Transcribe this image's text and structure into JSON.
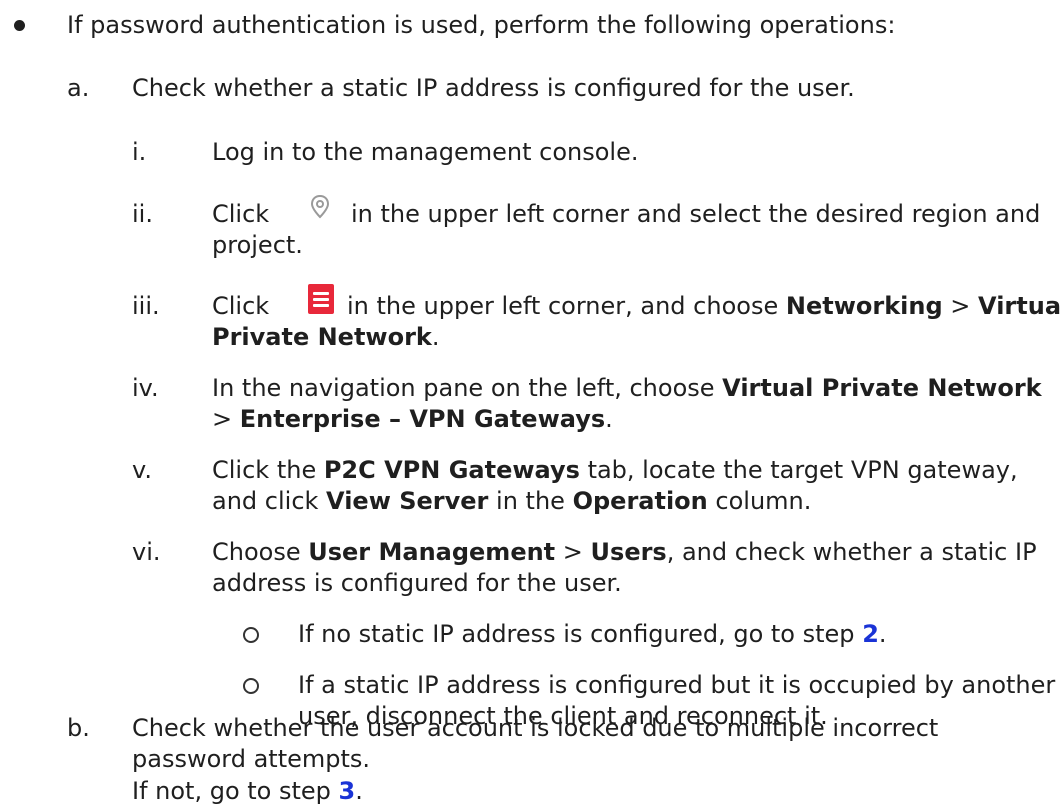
{
  "bullet_intro": "If password authentication is used, perform the following operations:",
  "step_a": {
    "marker": "a.",
    "text": "Check whether a static IP address is configured for the user.",
    "substeps": {
      "i": {
        "marker": "i.",
        "text": "Log in to the management console."
      },
      "ii": {
        "marker": "ii.",
        "text1_pre": "Click",
        "text1_post": "in the upper left corner and select the desired region and",
        "text2": "project.",
        "icon": "location-pin-icon"
      },
      "iii": {
        "marker": "iii.",
        "text1_pre": "Click",
        "text1_mid": "in the upper left corner, and choose",
        "bold1": "Networking",
        "sep": ">",
        "bold2": "Virtual",
        "bold3": "Private Network",
        "end": ".",
        "icon": "hamburger-menu-icon"
      },
      "iv": {
        "marker": "iv.",
        "text1": "In the navigation pane on the left, choose",
        "bold1": "Virtual Private Network",
        "sep": ">",
        "bold2": "Enterprise – VPN Gateways",
        "end": "."
      },
      "v": {
        "marker": "v.",
        "pre": "Click the",
        "bold1": "P2C VPN Gateways",
        "mid": "tab, locate the target VPN gateway,",
        "line2_pre": "and click",
        "bold2": "View Server",
        "line2_mid": "in the",
        "bold3": "Operation",
        "line2_end": "column."
      },
      "vi": {
        "marker": "vi.",
        "pre": "Choose",
        "bold1": "User Management",
        "sep": ">",
        "bold2": "Users",
        "mid": ", and check whether a static IP",
        "line2": "address is configured for the user.",
        "bullets": {
          "b1_pre": "If no static IP address is configured, go to step",
          "b1_link": "2",
          "b1_end": ".",
          "b2_line1": "If a static IP address is configured but it is occupied by another",
          "b2_line2": "user, disconnect the client and reconnect it."
        }
      }
    }
  },
  "step_b": {
    "marker": "b.",
    "line1": "Check whether the user account is locked due to multiple incorrect",
    "line2": "password attempts.",
    "note_pre": "If not, go to step",
    "note_link": "3",
    "note_end": "."
  },
  "colors": {
    "link": "#1a33d6",
    "menu_icon": "#e8283a",
    "text": "#1f1f1f"
  }
}
